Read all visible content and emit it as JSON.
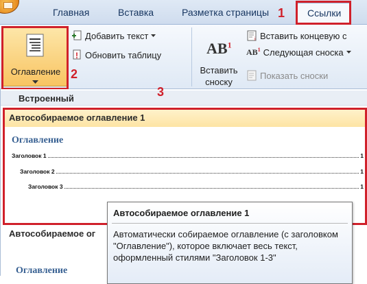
{
  "tabs": {
    "home": "Главная",
    "insert": "Вставка",
    "page_layout": "Разметка страницы",
    "references": "Ссылки"
  },
  "ribbon": {
    "toc_button": "Оглавление",
    "add_text": "Добавить текст",
    "update_table": "Обновить таблицу",
    "insert_footnote_line1": "Вставить",
    "insert_footnote_line2": "сноску",
    "insert_endnote": "Вставить концевую с",
    "next_footnote": "Следующая сноска",
    "show_notes": "Показать сноски",
    "footnote_icon_text": "AB",
    "footnote_icon_sup": "1",
    "endnote_icon_text": "AB",
    "endnote_icon_sup": "1"
  },
  "annotations": {
    "step1": "1",
    "step2": "2",
    "step3": "3"
  },
  "gallery": {
    "section_builtin": "Встроенный",
    "item1_title": "Автособираемое оглавление 1",
    "item1_preview": {
      "heading": "Оглавление",
      "lines": [
        {
          "text": "Заголовок 1",
          "page": "1"
        },
        {
          "text": "Заголовок 2",
          "page": "1"
        },
        {
          "text": "Заголовок 3",
          "page": "1"
        }
      ]
    },
    "item2_title": "Автособираемое ог",
    "item2_preview_heading": "Оглавление"
  },
  "tooltip": {
    "title": "Автособираемое оглавление 1",
    "body": "Автоматически собираемое оглавление (с заголовком \"Оглавление\"), которое включает весь текст, оформленный стилями \"Заголовок 1-3\""
  },
  "colors": {
    "highlight_red": "#d0202a",
    "ribbon_blue": "#dfe9f5",
    "selected_orange": "#fbd27a",
    "toc_heading_blue": "#365f91"
  }
}
